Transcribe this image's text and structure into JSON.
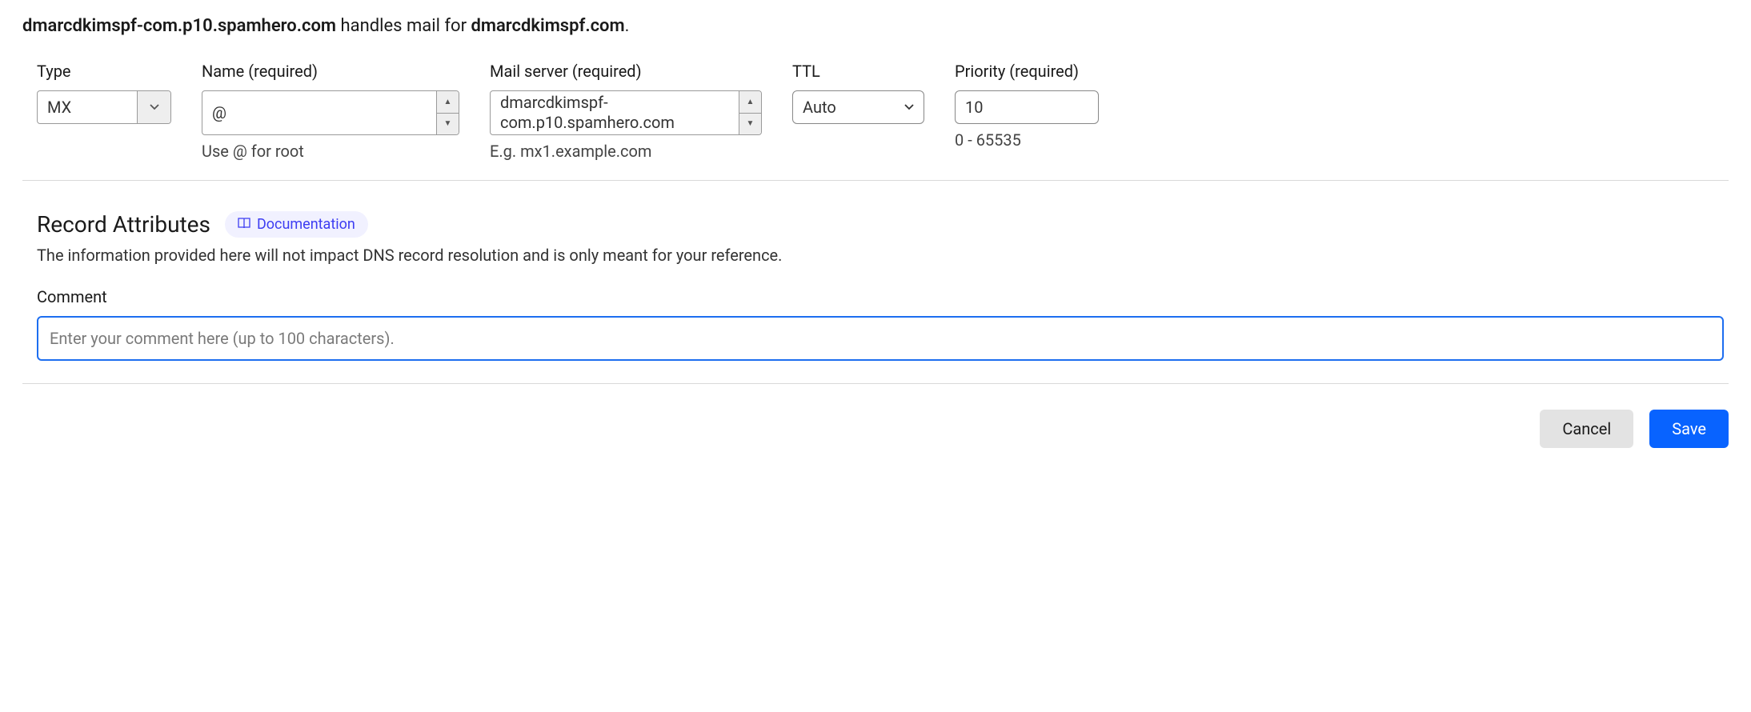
{
  "summary": {
    "server_host": "dmarcdkimspf-com.p10.spamhero.com",
    "middle_text": " handles mail for ",
    "domain": "dmarcdkimspf.com",
    "trailing": "."
  },
  "form": {
    "type": {
      "label": "Type",
      "value": "MX"
    },
    "name": {
      "label": "Name (required)",
      "value": "@",
      "hint": "Use @ for root"
    },
    "mail_server": {
      "label": "Mail server (required)",
      "value": "dmarcdkimspf-com.p10.spamhero.com",
      "hint": "E.g. mx1.example.com"
    },
    "ttl": {
      "label": "TTL",
      "value": "Auto"
    },
    "priority": {
      "label": "Priority (required)",
      "value": "10",
      "hint": "0 - 65535"
    }
  },
  "attrs": {
    "title": "Record Attributes",
    "doc_link": "Documentation",
    "description": "The information provided here will not impact DNS record resolution and is only meant for your reference.",
    "comment_label": "Comment",
    "comment_placeholder": "Enter your comment here (up to 100 characters)."
  },
  "buttons": {
    "cancel": "Cancel",
    "save": "Save"
  }
}
